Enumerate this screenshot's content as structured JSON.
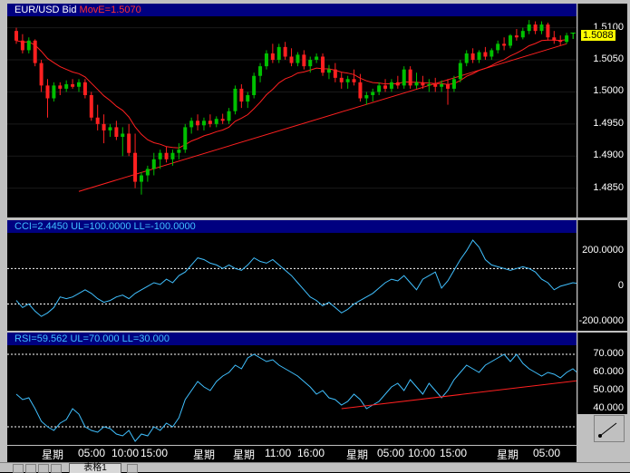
{
  "panes": {
    "price": {
      "header_symbol": "EUR/USD Bid",
      "header_ma": "MovE=1.5070",
      "current_price": "1.5088",
      "marker": "T"
    },
    "cci": {
      "header": "CCI=2.4450 UL=100.0000 LL=-100.0000"
    },
    "rsi": {
      "header": "RSI=59.562 UL=70.000 LL=30.000"
    }
  },
  "xaxis": {
    "ticks": [
      "星期",
      "05:00",
      "10:00",
      "15:00",
      "星期",
      "星期",
      "11:00",
      "16:00",
      "星期",
      "05:00",
      "10:00",
      "15:00",
      "星期",
      "05:00"
    ]
  },
  "bottom": {
    "tab_label": "表格1"
  },
  "colors": {
    "up": "#00c000",
    "down": "#ff2020",
    "ma": "#ff2020",
    "trend": "#ff2020",
    "indicator": "#40c0ff",
    "level": "#ffffff"
  },
  "chart_data": [
    {
      "type": "candlestick",
      "title": "EUR/USD Bid",
      "ylim": [
        1.481,
        1.5115
      ],
      "ticks": [
        1.485,
        1.49,
        1.495,
        1.5,
        1.505,
        1.51
      ],
      "tick_labels": [
        "1.4850",
        "1.4900",
        "1.4950",
        "1.5000",
        "1.5050",
        "1.5100"
      ],
      "series_ma_label": "MovE=1.5070",
      "candles": [
        [
          1.5095,
          1.51,
          1.5075,
          1.508
        ],
        [
          1.508,
          1.509,
          1.506,
          1.5065
        ],
        [
          1.5065,
          1.5085,
          1.506,
          1.508
        ],
        [
          1.508,
          1.5082,
          1.504,
          1.5045
        ],
        [
          1.5045,
          1.505,
          1.5,
          1.501
        ],
        [
          1.501,
          1.502,
          1.496,
          1.499
        ],
        [
          1.499,
          1.5015,
          1.4985,
          1.501
        ],
        [
          1.501,
          1.5015,
          1.4995,
          1.5005
        ],
        [
          1.5005,
          1.5018,
          1.5,
          1.5012
        ],
        [
          1.5012,
          1.502,
          1.5005,
          1.5008
        ],
        [
          1.5008,
          1.502,
          1.5,
          1.5015
        ],
        [
          1.5015,
          1.502,
          1.499,
          1.4995
        ],
        [
          1.4995,
          1.5,
          1.4955,
          1.496
        ],
        [
          1.496,
          1.498,
          1.494,
          1.495
        ],
        [
          1.495,
          1.4965,
          1.492,
          1.494
        ],
        [
          1.494,
          1.495,
          1.493,
          1.4945
        ],
        [
          1.4945,
          1.4955,
          1.4925,
          1.493
        ],
        [
          1.493,
          1.4945,
          1.49,
          1.4935
        ],
        [
          1.4935,
          1.495,
          1.49,
          1.4905
        ],
        [
          1.4905,
          1.4935,
          1.485,
          1.486
        ],
        [
          1.486,
          1.4875,
          1.484,
          1.487
        ],
        [
          1.487,
          1.4885,
          1.486,
          1.488
        ],
        [
          1.488,
          1.4905,
          1.487,
          1.4895
        ],
        [
          1.4895,
          1.491,
          1.488,
          1.4905
        ],
        [
          1.4905,
          1.4915,
          1.489,
          1.4895
        ],
        [
          1.4895,
          1.491,
          1.4885,
          1.4905
        ],
        [
          1.4905,
          1.492,
          1.4895,
          1.491
        ],
        [
          1.491,
          1.495,
          1.4905,
          1.4945
        ],
        [
          1.4945,
          1.496,
          1.4935,
          1.4955
        ],
        [
          1.4955,
          1.4965,
          1.494,
          1.4948
        ],
        [
          1.4948,
          1.496,
          1.494,
          1.4955
        ],
        [
          1.4955,
          1.4965,
          1.4945,
          1.495
        ],
        [
          1.495,
          1.4962,
          1.4945,
          1.4958
        ],
        [
          1.4958,
          1.4966,
          1.495,
          1.4955
        ],
        [
          1.4955,
          1.4975,
          1.495,
          1.497
        ],
        [
          1.497,
          1.501,
          1.4965,
          1.5005
        ],
        [
          1.5005,
          1.5012,
          1.4975,
          1.4985
        ],
        [
          1.4985,
          1.5,
          1.4975,
          1.4995
        ],
        [
          1.4995,
          1.503,
          1.499,
          1.5025
        ],
        [
          1.5025,
          1.5045,
          1.5015,
          1.504
        ],
        [
          1.504,
          1.5065,
          1.5035,
          1.506
        ],
        [
          1.506,
          1.5075,
          1.5045,
          1.505
        ],
        [
          1.505,
          1.5075,
          1.5045,
          1.507
        ],
        [
          1.507,
          1.5078,
          1.505,
          1.5055
        ],
        [
          1.5055,
          1.5068,
          1.504,
          1.5045
        ],
        [
          1.5045,
          1.5062,
          1.504,
          1.5058
        ],
        [
          1.5058,
          1.5065,
          1.5035,
          1.504
        ],
        [
          1.504,
          1.5055,
          1.503,
          1.505
        ],
        [
          1.505,
          1.506,
          1.5045,
          1.5055
        ],
        [
          1.5055,
          1.506,
          1.5025,
          1.503
        ],
        [
          1.503,
          1.5042,
          1.502,
          1.5035
        ],
        [
          1.5035,
          1.5045,
          1.5015,
          1.5022
        ],
        [
          1.5022,
          1.503,
          1.5005,
          1.5015
        ],
        [
          1.5015,
          1.5025,
          1.5005,
          1.502
        ],
        [
          1.502,
          1.5035,
          1.501,
          1.5015
        ],
        [
          1.5015,
          1.5028,
          1.4985,
          1.499
        ],
        [
          1.499,
          1.5,
          1.498,
          1.4995
        ],
        [
          1.4995,
          1.5005,
          1.4985,
          1.5
        ],
        [
          1.5,
          1.5015,
          1.4995,
          1.501
        ],
        [
          1.501,
          1.502,
          1.5,
          1.5005
        ],
        [
          1.5005,
          1.502,
          1.5,
          1.5015
        ],
        [
          1.5015,
          1.5025,
          1.5005,
          1.501
        ],
        [
          1.501,
          1.504,
          1.5005,
          1.5035
        ],
        [
          1.5035,
          1.504,
          1.5005,
          1.501
        ],
        [
          1.501,
          1.503,
          1.5005,
          1.5015
        ],
        [
          1.5015,
          1.5025,
          1.5005,
          1.501
        ],
        [
          1.501,
          1.502,
          1.5,
          1.5012
        ],
        [
          1.5012,
          1.5022,
          1.5,
          1.5008
        ],
        [
          1.5008,
          1.5018,
          1.5,
          1.5012
        ],
        [
          1.5012,
          1.502,
          1.498,
          1.5005
        ],
        [
          1.5005,
          1.5025,
          1.5,
          1.502
        ],
        [
          1.502,
          1.505,
          1.5015,
          1.5045
        ],
        [
          1.5045,
          1.5065,
          1.504,
          1.506
        ],
        [
          1.506,
          1.5068,
          1.5045,
          1.505
        ],
        [
          1.505,
          1.5065,
          1.5045,
          1.5062
        ],
        [
          1.5062,
          1.507,
          1.505,
          1.5055
        ],
        [
          1.5055,
          1.5068,
          1.505,
          1.5065
        ],
        [
          1.5065,
          1.508,
          1.506,
          1.5075
        ],
        [
          1.5075,
          1.5085,
          1.5065,
          1.5072
        ],
        [
          1.5072,
          1.509,
          1.5068,
          1.5088
        ],
        [
          1.5088,
          1.5098,
          1.508,
          1.5085
        ],
        [
          1.5085,
          1.51,
          1.5082,
          1.5095
        ],
        [
          1.5095,
          1.5112,
          1.509,
          1.5105
        ],
        [
          1.5105,
          1.511,
          1.509,
          1.5095
        ],
        [
          1.5095,
          1.511,
          1.509,
          1.5105
        ],
        [
          1.5105,
          1.5108,
          1.508,
          1.5085
        ],
        [
          1.5085,
          1.5095,
          1.5075,
          1.508
        ],
        [
          1.508,
          1.5088,
          1.5072,
          1.5078
        ],
        [
          1.5078,
          1.5092,
          1.5075,
          1.5088
        ]
      ],
      "trend_lines": [
        {
          "from": [
            10,
            1.4845
          ],
          "to": [
            88,
            1.5075
          ]
        }
      ]
    },
    {
      "type": "line",
      "title": "CCI=2.4450 UL=100.0000 LL=-100.0000",
      "ylim": [
        -230,
        270
      ],
      "tick_labels": [
        "200.0000",
        "0",
        "-200.0000"
      ],
      "ticks": [
        200,
        0,
        -200
      ],
      "levels": [
        100,
        -100
      ],
      "values": [
        -80,
        -120,
        -100,
        -140,
        -170,
        -150,
        -120,
        -60,
        -70,
        -60,
        -40,
        -20,
        -40,
        -70,
        -90,
        -80,
        -60,
        -50,
        -70,
        -40,
        -20,
        0,
        20,
        10,
        40,
        20,
        60,
        80,
        120,
        160,
        150,
        130,
        120,
        100,
        120,
        100,
        90,
        120,
        160,
        140,
        130,
        150,
        120,
        90,
        60,
        20,
        -20,
        -60,
        -80,
        -110,
        -90,
        -120,
        -150,
        -130,
        -100,
        -80,
        -60,
        -40,
        -10,
        20,
        40,
        30,
        60,
        20,
        -20,
        40,
        60,
        80,
        -10,
        30,
        90,
        150,
        200,
        260,
        220,
        150,
        120,
        110,
        100,
        90,
        100,
        110,
        100,
        80,
        40,
        20,
        -20,
        0,
        10,
        20,
        15,
        0,
        -10
      ]
    },
    {
      "type": "line",
      "title": "RSI=59.562 UL=70.000 LL=30.000",
      "ylim": [
        22,
        73
      ],
      "tick_labels": [
        "70.000",
        "60.000",
        "50.000",
        "40.000",
        "30.000"
      ],
      "ticks": [
        70,
        60,
        50,
        40,
        30
      ],
      "levels": [
        70,
        30
      ],
      "values": [
        48,
        45,
        46,
        40,
        33,
        30,
        28,
        32,
        34,
        40,
        37,
        30,
        28,
        27,
        30,
        29,
        26,
        25,
        28,
        22,
        26,
        25,
        30,
        28,
        32,
        30,
        35,
        45,
        50,
        55,
        52,
        50,
        55,
        58,
        60,
        64,
        62,
        68,
        70,
        68,
        66,
        67,
        64,
        62,
        60,
        58,
        55,
        52,
        48,
        50,
        46,
        45,
        42,
        44,
        48,
        45,
        40,
        42,
        44,
        48,
        52,
        54,
        50,
        56,
        52,
        48,
        54,
        50,
        46,
        50,
        56,
        60,
        64,
        62,
        60,
        64,
        66,
        68,
        70,
        66,
        70,
        65,
        62,
        60,
        58,
        60,
        59,
        57,
        60,
        62,
        59
      ],
      "trend_lines": [
        {
          "from": [
            52,
            40
          ],
          "to": [
            96,
            58
          ]
        }
      ]
    }
  ]
}
